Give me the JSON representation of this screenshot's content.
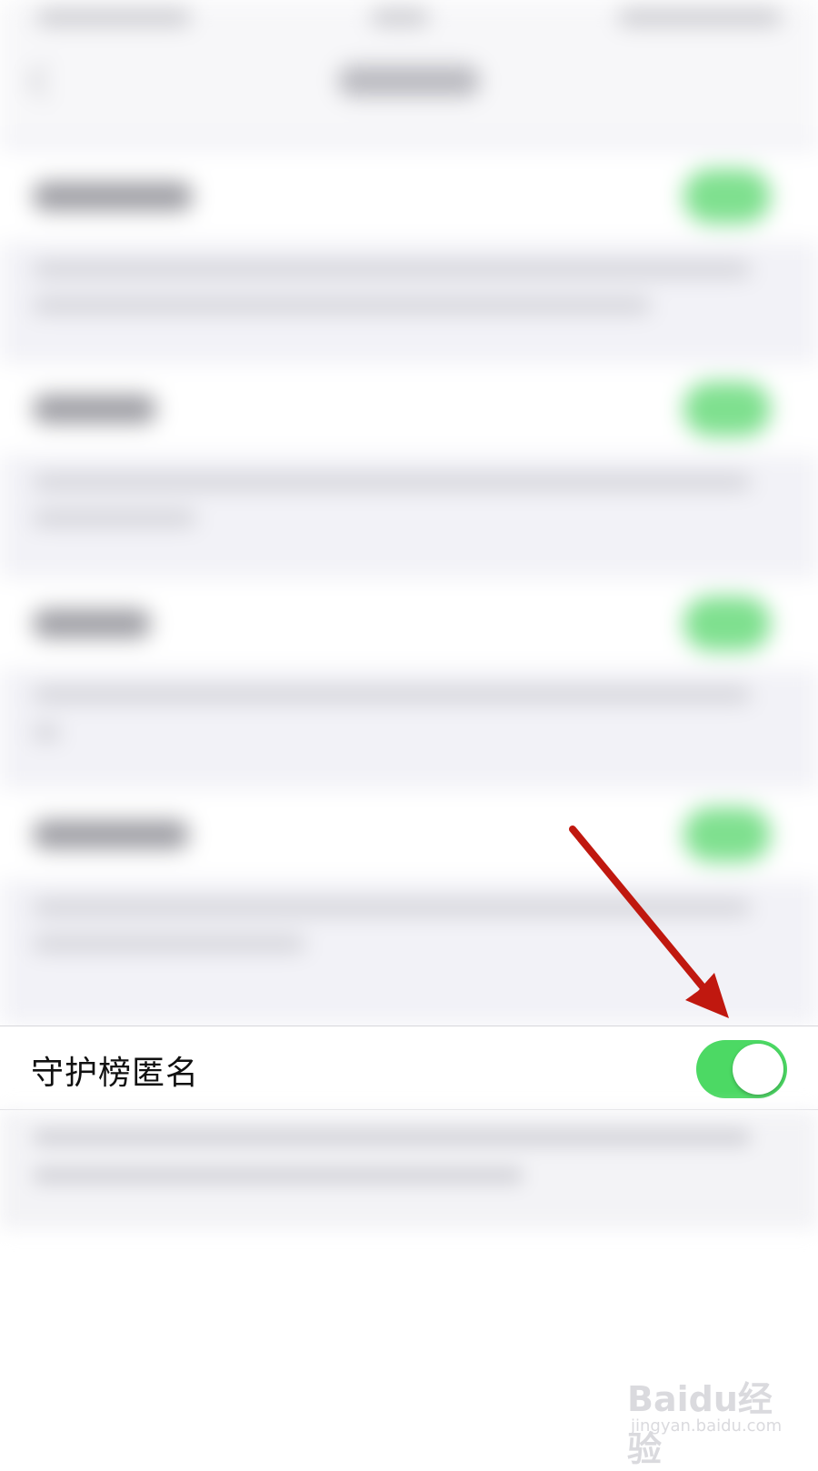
{
  "setting_row": {
    "label": "守护榜匿名",
    "toggle_on": true,
    "toggle_color": "#4cd964"
  },
  "annotation": {
    "arrow_color": "#c0180f",
    "arrow_icon": "red-arrow-icon"
  },
  "watermark": {
    "brand": "Baidu经验",
    "url": "jingyan.baidu.com"
  }
}
